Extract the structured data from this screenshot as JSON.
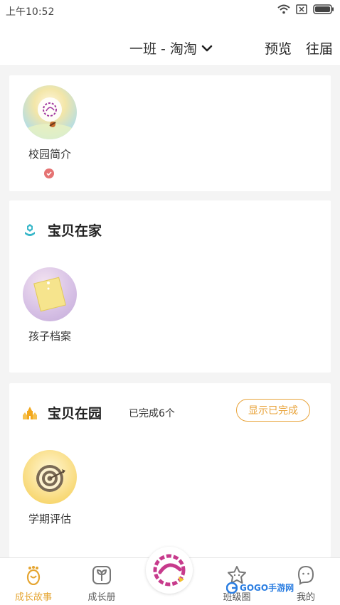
{
  "status_bar": {
    "time": "上午10:52"
  },
  "app_bar": {
    "class_selector": "一班 - 淘淘",
    "preview": "预览",
    "previous_years": "往届"
  },
  "campus_card": {
    "tile_label": "校园简介"
  },
  "home_section": {
    "title": "宝贝在家",
    "tile_label": "孩子档案"
  },
  "school_section": {
    "title": "宝贝在园",
    "completed_text": "已完成6个",
    "show_completed_button": "显示已完成",
    "tile_label": "学期评估"
  },
  "tab_bar": {
    "tabs": [
      {
        "label": "成长故事",
        "active": true
      },
      {
        "label": "成长册",
        "active": false
      },
      {
        "label": "班级圈",
        "active": false
      },
      {
        "label": "我的",
        "active": false
      }
    ]
  },
  "watermark": {
    "text": "GOGO手游网"
  },
  "colors": {
    "accent": "#e5a531",
    "button_border": "#e8a33a",
    "check": "#e57373",
    "home_icon": "#38b7c9"
  }
}
